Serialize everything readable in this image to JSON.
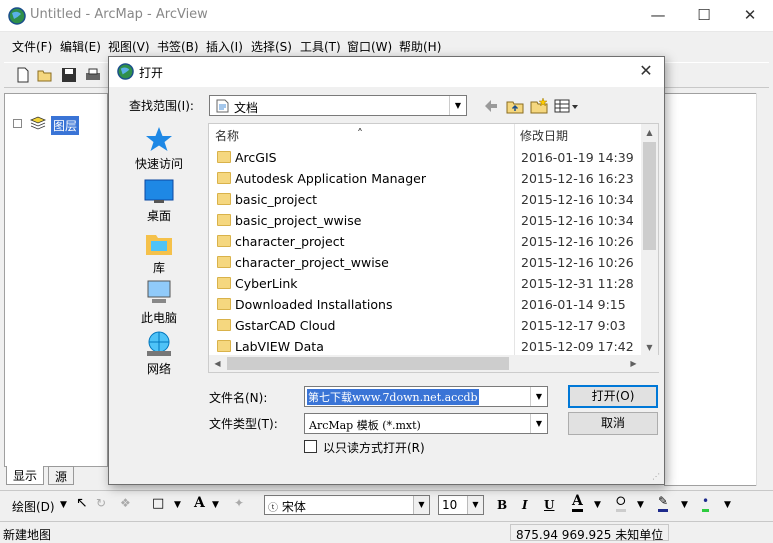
{
  "window": {
    "title": "Untitled - ArcMap - ArcView",
    "minimize_icon": "minimize-icon",
    "maximize_icon": "maximize-icon",
    "close_icon": "close-icon"
  },
  "menubar": [
    "文件(F)",
    "编辑(E)",
    "视图(V)",
    "书签(B)",
    "插入(I)",
    "选择(S)",
    "工具(T)",
    "窗口(W)",
    "帮助(H)"
  ],
  "toc": {
    "root_label": "图层",
    "tabs": [
      "显示",
      "源"
    ]
  },
  "dialog": {
    "title": "打开",
    "look_in_label": "查找范围(I):",
    "look_in_value": "文档",
    "places": [
      "快速访问",
      "桌面",
      "库",
      "此电脑",
      "网络"
    ],
    "columns": {
      "name": "名称",
      "modified": "修改日期"
    },
    "rows": [
      {
        "name": "ArcGIS",
        "date": "2016-01-19 14:39"
      },
      {
        "name": "Autodesk Application Manager",
        "date": "2015-12-16 16:23"
      },
      {
        "name": "basic_project",
        "date": "2015-12-16 10:34"
      },
      {
        "name": "basic_project_wwise",
        "date": "2015-12-16 10:34"
      },
      {
        "name": "character_project",
        "date": "2015-12-16 10:26"
      },
      {
        "name": "character_project_wwise",
        "date": "2015-12-16 10:26"
      },
      {
        "name": "CyberLink",
        "date": "2015-12-31 11:28"
      },
      {
        "name": "Downloaded Installations",
        "date": "2016-01-14 9:15"
      },
      {
        "name": "GstarCAD Cloud",
        "date": "2015-12-17 9:03"
      },
      {
        "name": "LabVIEW Data",
        "date": "2015-12-09 17:42"
      }
    ],
    "file_name_label": "文件名(N):",
    "file_name_value": "第七下载www.7down.net.accdb",
    "file_type_label": "文件类型(T):",
    "file_type_value": "ArcMap 模板 (*.mxt)",
    "open_button": "打开(O)",
    "cancel_button": "取消",
    "readonly_label": "以只读方式打开(R)"
  },
  "drawbar": {
    "draw_label": "绘图(D)",
    "font_name": "宋体",
    "font_size": "10",
    "bold": "B",
    "italic": "I",
    "underline": "U",
    "text_tool": "A"
  },
  "status": {
    "left": "新建地图",
    "coords": "875.94  969.925 未知单位"
  },
  "colors": {
    "selection": "#3a74d6",
    "folder": "#f5d77f",
    "default_button_border": "#0078d7"
  }
}
